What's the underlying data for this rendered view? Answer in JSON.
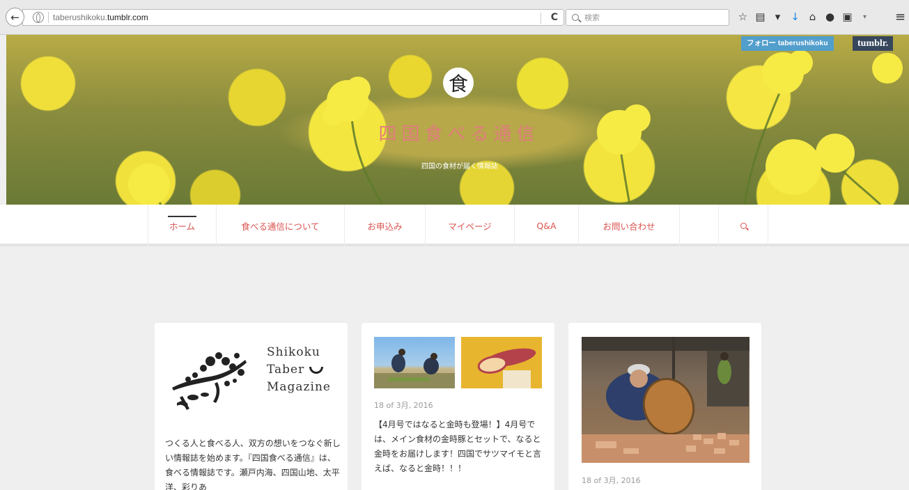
{
  "browser": {
    "url_prefix": "taberushikoku.",
    "url_domain": "tumblr.com",
    "search_placeholder": "検索",
    "toolbar_icons": [
      "star-icon",
      "reading-list-icon",
      "pocket-icon",
      "download-icon",
      "home-icon",
      "chat-icon",
      "screenshot-icon",
      "dropdown-icon",
      "menu-icon"
    ]
  },
  "header": {
    "logo_char": "食",
    "site_title": "四国食べる通信",
    "tagline": "四国の食材が届く情報誌",
    "follow_label": "フォロー taberushikoku",
    "tumblr_label": "tumblr."
  },
  "nav": {
    "items": [
      {
        "label": "ホーム",
        "active": true
      },
      {
        "label": "食べる通信について"
      },
      {
        "label": "お申込み"
      },
      {
        "label": "マイページ"
      },
      {
        "label": "Q&A"
      },
      {
        "label": "お問い合わせ"
      },
      {
        "label": ""
      }
    ]
  },
  "cards": [
    {
      "magazine_name": [
        "Shikoku",
        "Taber",
        "Magazine"
      ],
      "intro": "つくる人と食べる人、双方の想いをつなぐ新しい情報誌を始めます。『四国食べる通信』は、食べる情報誌です。瀬戸内海、四国山地、太平洋、彩りあ"
    },
    {
      "date": "18 of 3月, 2016",
      "text": "【4月号ではなると金時も登場！】4月号では、メイン食材の金時豚とセットで、なると金時をお届けします！四国でサツマイモと言えば、なると金時！！！"
    },
    {
      "date": "18 of 3月, 2016"
    }
  ],
  "colors": {
    "accent": "#d9534f",
    "title_pink": "#e07d7d",
    "tumblr_blue": "#529ecc",
    "tumblr_navy": "#36465d",
    "background": "#efefef"
  }
}
